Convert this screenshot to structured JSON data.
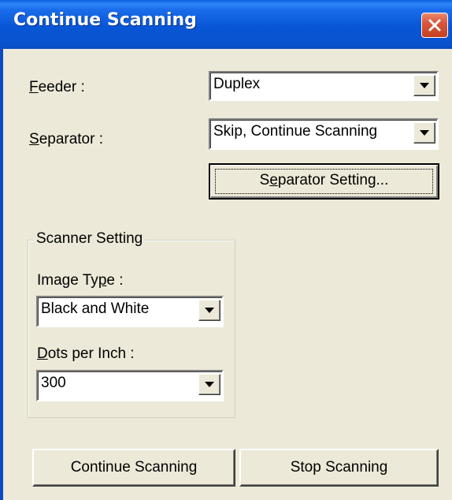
{
  "window": {
    "title": "Continue Scanning"
  },
  "feeder": {
    "label_mnemonic": "F",
    "label_rest": "eeder :",
    "value": "Duplex"
  },
  "separator": {
    "label_mnemonic": "S",
    "label_rest": "eparator :",
    "value": "Skip, Continue Scanning"
  },
  "separator_setting_button": {
    "pre": "S",
    "mnemonic": "e",
    "post": "parator Setting..."
  },
  "scanner_setting": {
    "group_title": "Scanner Setting",
    "image_type": {
      "label_pre": "Image Ty",
      "label_mnemonic": "p",
      "label_post": "e :",
      "value": "Black and White"
    },
    "dpi": {
      "label_mnemonic": "D",
      "label_rest": "ots per Inch :",
      "value": "300"
    }
  },
  "footer": {
    "continue_label": "Continue Scanning",
    "stop_label": "Stop Scanning"
  },
  "colors": {
    "title_bar": "#0853CF",
    "dialog_face": "#ECE9D8",
    "close_button": "#D9573A"
  },
  "icons": {
    "close": "close-icon",
    "dropdown": "chevron-down-icon"
  }
}
